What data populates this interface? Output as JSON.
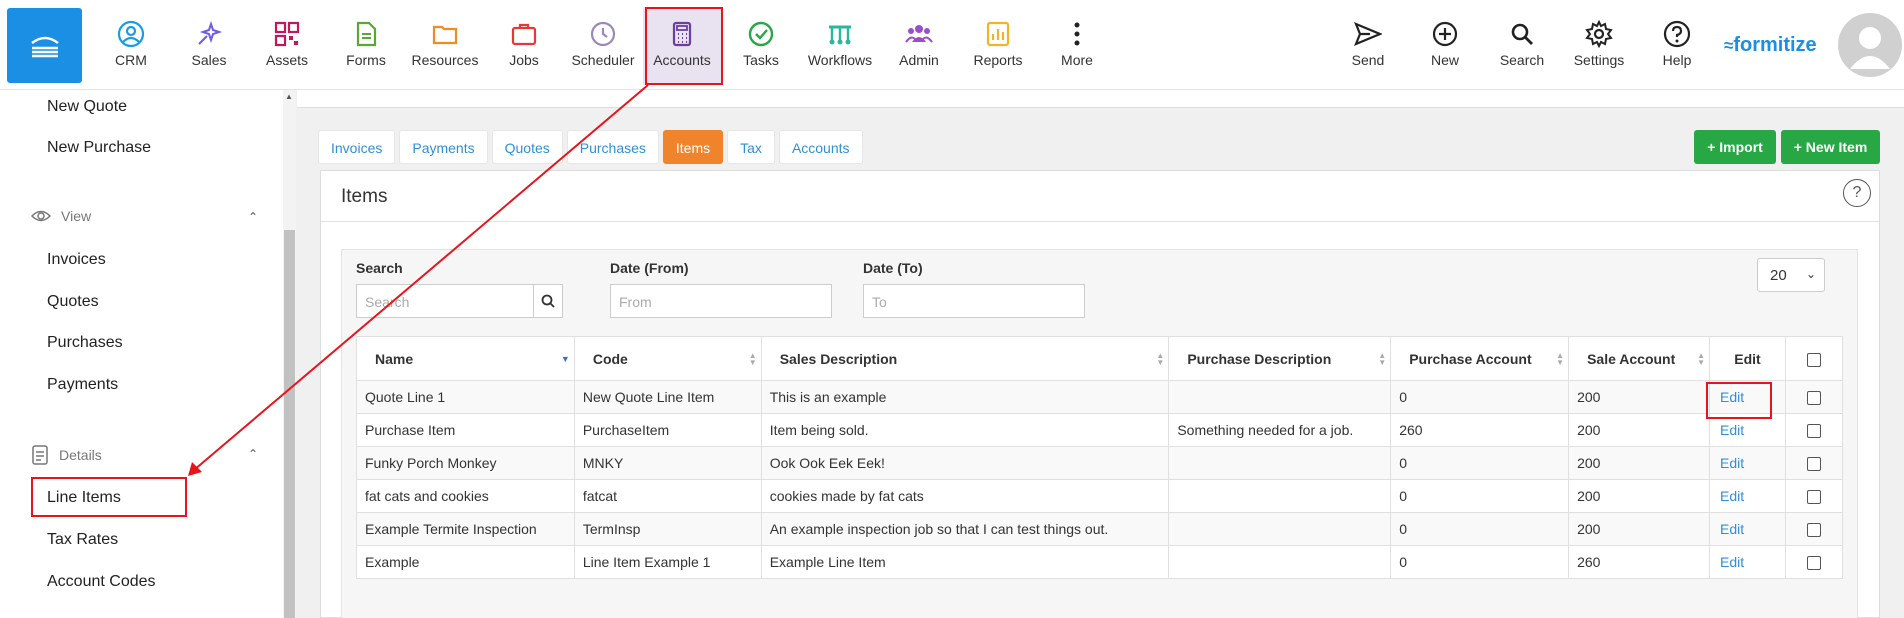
{
  "topnav": {
    "items": [
      {
        "label": "CRM",
        "icon": "person-circle-icon",
        "color": "#1a9be6"
      },
      {
        "label": "Sales",
        "icon": "sparkles-icon",
        "color": "#6b5ce7"
      },
      {
        "label": "Assets",
        "icon": "qr-code-icon",
        "color": "#c2185b"
      },
      {
        "label": "Forms",
        "icon": "document-icon",
        "color": "#5aa832"
      },
      {
        "label": "Resources",
        "icon": "folder-icon",
        "color": "#f08a24"
      },
      {
        "label": "Jobs",
        "icon": "briefcase-icon",
        "color": "#e53935"
      },
      {
        "label": "Scheduler",
        "icon": "clock-icon",
        "color": "#9c88b8"
      },
      {
        "label": "Accounts",
        "icon": "calculator-icon",
        "color": "#6b3fa0"
      },
      {
        "label": "Tasks",
        "icon": "check-circle-icon",
        "color": "#28a745"
      },
      {
        "label": "Workflows",
        "icon": "workflow-icon",
        "color": "#2fb59a"
      },
      {
        "label": "Admin",
        "icon": "people-icon",
        "color": "#9c4dcc"
      },
      {
        "label": "Reports",
        "icon": "bar-chart-icon",
        "color": "#f0b429"
      },
      {
        "label": "More",
        "icon": "more-vertical-icon",
        "color": "#222222"
      }
    ],
    "right_items": [
      {
        "label": "Send",
        "icon": "send-icon"
      },
      {
        "label": "New",
        "icon": "plus-circle-icon"
      },
      {
        "label": "Search",
        "icon": "search-icon"
      },
      {
        "label": "Settings",
        "icon": "gear-icon"
      },
      {
        "label": "Help",
        "icon": "help-circle-icon"
      }
    ],
    "logo": "formitize",
    "active": "Accounts"
  },
  "sidebar": {
    "top_links": [
      "New Quote",
      "New Purchase"
    ],
    "view_section": {
      "title": "View",
      "links": [
        "Invoices",
        "Quotes",
        "Purchases",
        "Payments"
      ]
    },
    "details_section": {
      "title": "Details",
      "links": [
        "Line Items",
        "Tax Rates",
        "Account Codes"
      ]
    }
  },
  "tabs": [
    "Invoices",
    "Payments",
    "Quotes",
    "Purchases",
    "Items",
    "Tax",
    "Accounts"
  ],
  "active_tab": "Items",
  "buttons": {
    "import": "+ Import",
    "new_item": "+ New Item"
  },
  "panel": {
    "title": "Items",
    "help": "?",
    "filters": {
      "search_label": "Search",
      "search_placeholder": "Search",
      "date_from_label": "Date (From)",
      "date_from_placeholder": "From",
      "date_to_label": "Date (To)",
      "date_to_placeholder": "To",
      "page_size": "20"
    },
    "columns": [
      "Name",
      "Code",
      "Sales Description",
      "Purchase Description",
      "Purchase Account",
      "Sale Account",
      "Edit"
    ],
    "rows": [
      {
        "name": "Quote Line 1",
        "code": "New Quote Line Item",
        "sales_desc": "This is an example",
        "purchase_desc": "",
        "purchase_account": "0",
        "sale_account": "200",
        "edit": "Edit"
      },
      {
        "name": "Purchase Item",
        "code": "PurchaseItem",
        "sales_desc": "Item being sold.",
        "purchase_desc": "Something needed for a job.",
        "purchase_account": "260",
        "sale_account": "200",
        "edit": "Edit"
      },
      {
        "name": "Funky Porch Monkey",
        "code": "MNKY",
        "sales_desc": "Ook Ook Eek Eek!",
        "purchase_desc": "",
        "purchase_account": "0",
        "sale_account": "200",
        "edit": "Edit"
      },
      {
        "name": "fat cats and cookies",
        "code": "fatcat",
        "sales_desc": "cookies made by fat cats",
        "purchase_desc": "",
        "purchase_account": "0",
        "sale_account": "200",
        "edit": "Edit"
      },
      {
        "name": "Example Termite Inspection",
        "code": "TermInsp",
        "sales_desc": "An example inspection job so that I can test things out.",
        "purchase_desc": "",
        "purchase_account": "0",
        "sale_account": "200",
        "edit": "Edit"
      },
      {
        "name": "Example",
        "code": "Line Item Example 1",
        "sales_desc": "Example Line Item",
        "purchase_desc": "",
        "purchase_account": "0",
        "sale_account": "260",
        "edit": "Edit"
      }
    ]
  },
  "colors": {
    "primary": "#1a8fe3",
    "accent_tab": "#f0842c",
    "green": "#28a745",
    "highlight": "#e8141c",
    "link": "#2f8fd8"
  }
}
